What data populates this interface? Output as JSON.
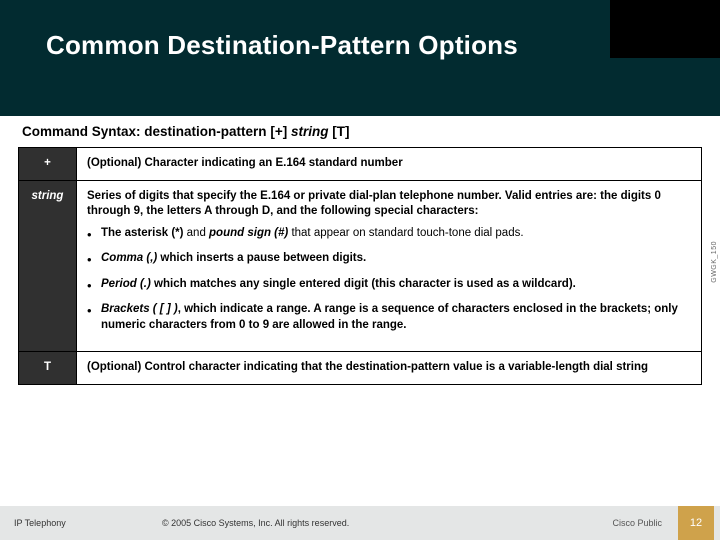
{
  "slide": {
    "title": "Common Destination-Pattern Options"
  },
  "syntax": {
    "label": "Command Syntax:",
    "command": "destination-pattern",
    "plus": "[+]",
    "string": "string",
    "t": "[T]"
  },
  "rows": {
    "plus": {
      "key": "+",
      "text": "(Optional) Character indicating an E.164 standard number"
    },
    "string": {
      "key": "string",
      "lead": "Series of digits that specify the E.164 or private dial-plan telephone number. Valid entries are: the digits 0 through 9, the letters A through D, and the following special characters:",
      "b1_bold": "The asterisk (*)",
      "b1_mid": " and ",
      "b1_bi": "pound sign (#)",
      "b1_tail": " that appear on standard touch-tone dial pads.",
      "b2_bi": "Comma (,)",
      "b2_tail": " which inserts a pause between digits.",
      "b3_bi": "Period (.)",
      "b3_tail": "  which matches any single entered digit (this character is used as a wildcard).",
      "b4_bi": "Brackets ( [ ] )",
      "b4_tail": ", which indicate a range. A range is a sequence of characters enclosed in the brackets; only numeric characters from 0 to 9 are allowed in the range."
    },
    "t": {
      "key": "T",
      "text": "(Optional) Control character indicating that the destination-pattern value is a variable-length dial string"
    }
  },
  "watermark": "GWGK_150",
  "footer": {
    "left": "IP Telephony",
    "center": "© 2005 Cisco Systems, Inc. All rights reserved.",
    "right": "Cisco Public",
    "page": "12"
  }
}
